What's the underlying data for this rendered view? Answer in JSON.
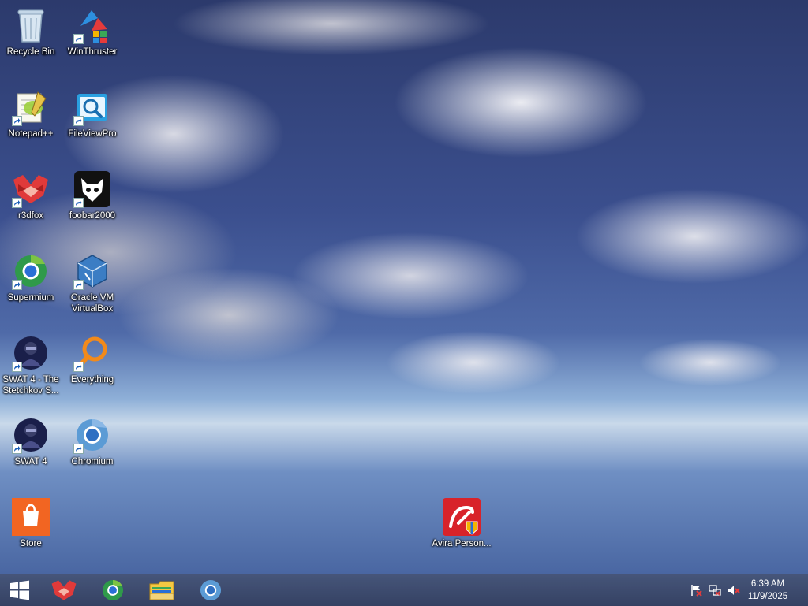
{
  "desktop": {
    "icons": [
      {
        "label": "Recycle Bin",
        "icon": "recycle-bin-icon"
      },
      {
        "label": "WinThruster",
        "icon": "winthruster-icon"
      },
      {
        "label": "Notepad++",
        "icon": "notepad-plus-plus-icon"
      },
      {
        "label": "FileViewPro",
        "icon": "fileviewpro-icon"
      },
      {
        "label": "r3dfox",
        "icon": "r3dfox-icon"
      },
      {
        "label": "foobar2000",
        "icon": "foobar2000-icon"
      },
      {
        "label": "Supermium",
        "icon": "supermium-icon"
      },
      {
        "label": "Oracle VM VirtualBox",
        "icon": "virtualbox-icon"
      },
      {
        "label": "SWAT 4 - The Stetchkov S...",
        "icon": "swat4-stetchkov-icon"
      },
      {
        "label": "Everything",
        "icon": "everything-search-icon"
      },
      {
        "label": "SWAT 4",
        "icon": "swat4-icon"
      },
      {
        "label": "Chromium",
        "icon": "chromium-icon"
      },
      {
        "label": "Store",
        "icon": "store-icon"
      },
      {
        "label": "Avira Person...",
        "icon": "avira-icon"
      }
    ]
  },
  "taskbar": {
    "start": "windows-start-icon",
    "pinned": [
      "r3dfox-icon",
      "supermium-icon",
      "file-explorer-icon",
      "chromium-icon"
    ],
    "tray": [
      "action-center-flag-icon",
      "network-icon",
      "volume-muted-icon"
    ],
    "clock": {
      "time": "6:39 AM",
      "date": "11/9/2025"
    }
  },
  "colors": {
    "taskbar": "#3a4a72",
    "avira": "#d8232a",
    "store": "#f26522",
    "r3dfox": "#e03a3a"
  }
}
